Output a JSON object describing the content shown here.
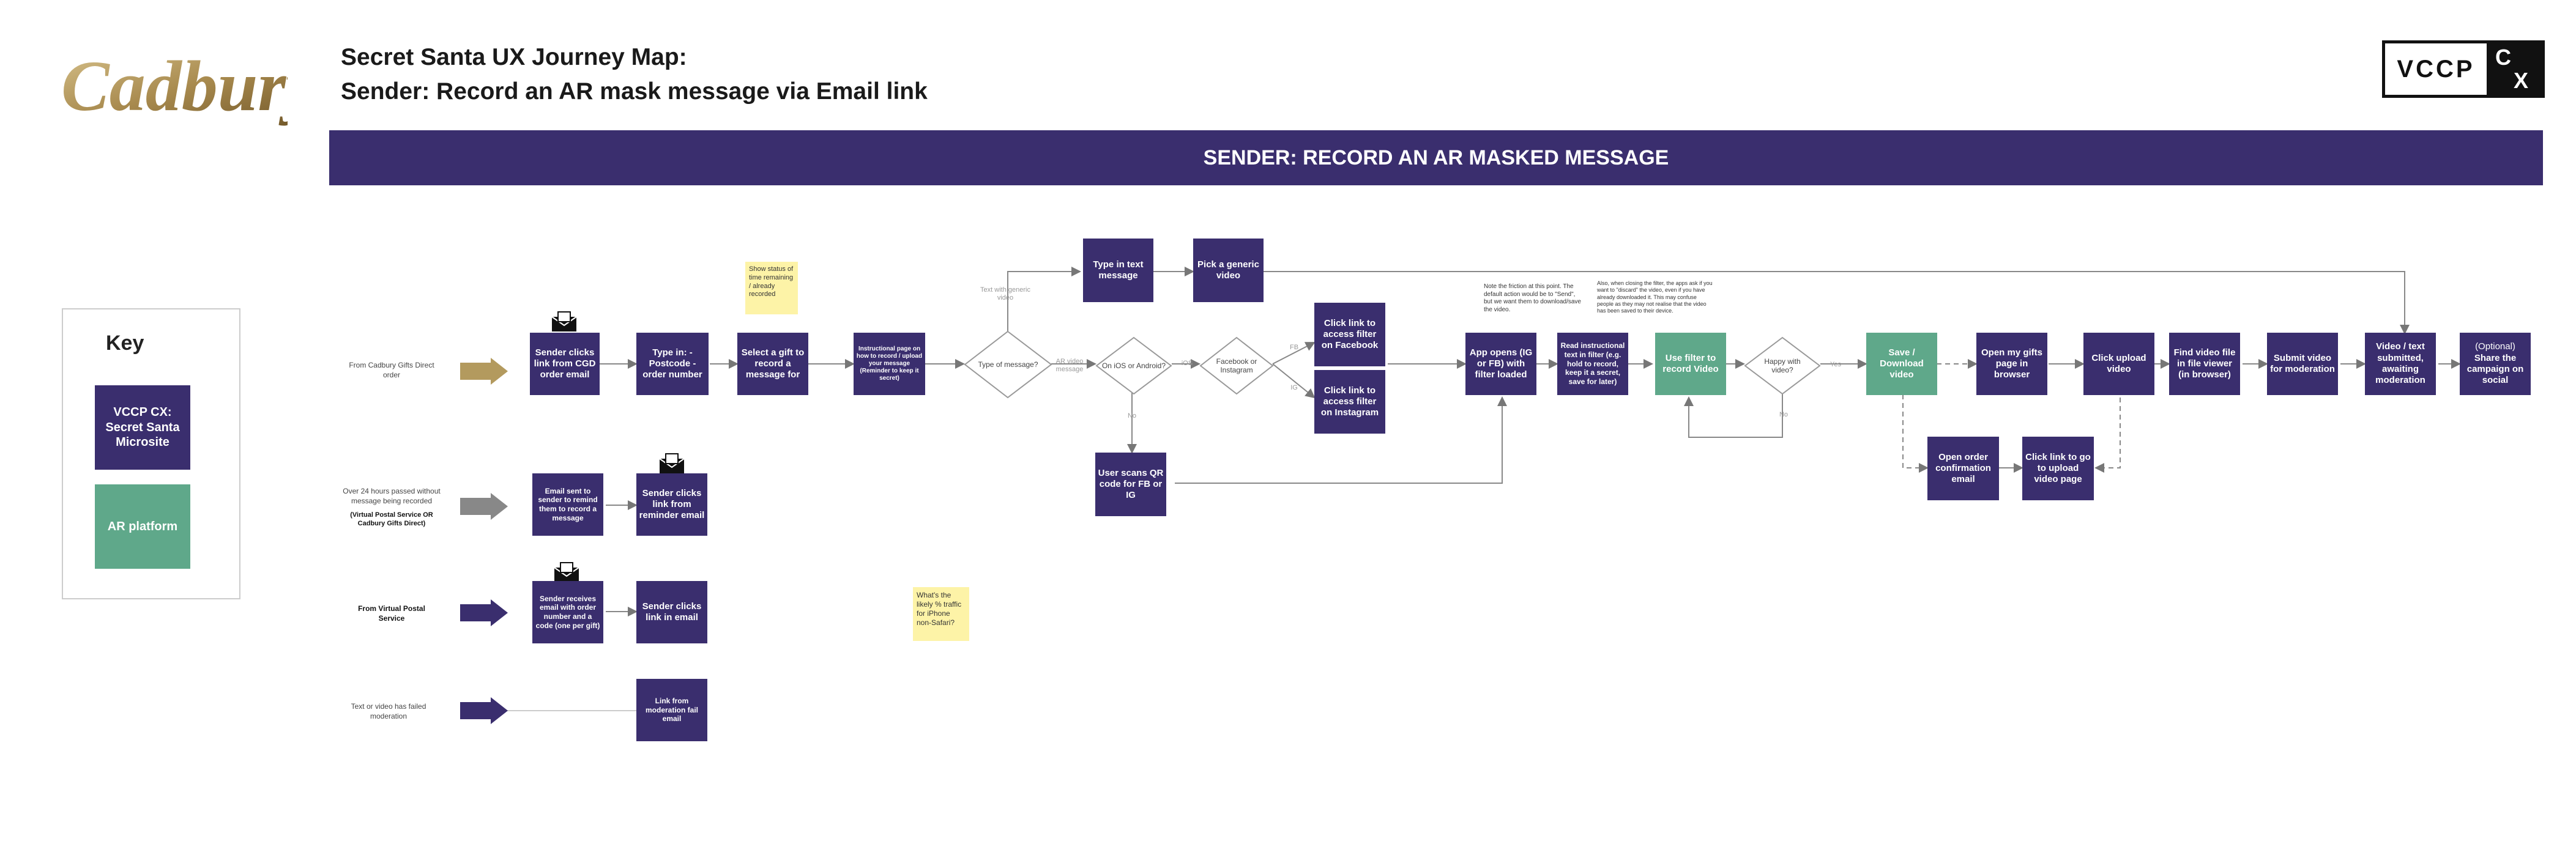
{
  "header": {
    "brand_logo_text": "Cadbury",
    "title_line1": "Secret Santa UX Journey Map:",
    "title_line2": "Sender: Record an AR mask message via Email link",
    "agency_logo_left": "VCCP",
    "agency_logo_right_top": "C",
    "agency_logo_right_bottom": "X"
  },
  "banner": {
    "title": "SENDER: RECORD AN AR MASKED MESSAGE"
  },
  "key": {
    "title": "Key",
    "items": [
      {
        "label": "VCCP CX: Secret Santa Microsite",
        "color": "#3a2e6e"
      },
      {
        "label": "AR platform",
        "color": "#5fa88a"
      }
    ]
  },
  "colors": {
    "primary": "#3a2e6e",
    "ar_platform": "#5fa88a",
    "gold": "#b39a5e",
    "grey": "#888888",
    "note": "#fdf3a7"
  },
  "entry_points": [
    {
      "label": "From Cadbury Gifts Direct order",
      "sub": ""
    },
    {
      "label": "Over 24 hours passed without message being recorded",
      "sub": "(Virtual Postal Service OR Cadbury Gifts Direct)"
    },
    {
      "label": "From Virtual Postal Service",
      "sub": ""
    },
    {
      "label": "Text or video has failed moderation",
      "sub": ""
    }
  ],
  "steps": {
    "sender_clicks_cgd": "Sender clicks link from CGD order email",
    "type_in": "Type in: - Postcode - order number",
    "select_gift": "Select a gift to record a message for",
    "email_sent": "Email sent to sender to remind them to record a message",
    "sender_clicks_reminder": "Sender clicks link from reminder email",
    "sender_receives": "Sender receives email with order number and a code (one per gift)",
    "sender_clicks_link": "Sender clicks link in email",
    "link_moderation": "Link from moderation fail email",
    "instructional_page": "Instructional page on how to record / upload your message (Reminder to keep it secret)",
    "type_text": "Type in text message",
    "pick_generic": "Pick a generic video",
    "user_scans_qr": "User scans QR code for FB or IG",
    "filter_facebook": "Click link to access filter on Facebook",
    "filter_instagram": "Click link to access filter on Instagram",
    "app_opens": "App opens (IG or FB) with filter loaded",
    "read_instructional": "Read instructional text in filter (e.g. hold to record, keep it a secret, save for later)",
    "use_filter": "Use filter to record Video",
    "save_download": "Save / Download video",
    "open_gifts_page": "Open my gifts page in browser",
    "click_upload": "Click upload video",
    "find_video": "Find video file in file viewer (in browser)",
    "submit_video": "Submit video for moderation",
    "video_submitted": "Video / text submitted, awaiting moderation",
    "share_optional": "(Optional)",
    "share": "Share the campaign on social",
    "open_order_email": "Open order confirmation email",
    "click_link_upload_page": "Click link to go to upload video page"
  },
  "decisions": {
    "type_of_message": "Type of message?",
    "ios_android": "On iOS or Android?",
    "fb_ig": "Facebook or Instagram",
    "happy": "Happy with video?"
  },
  "edge_labels": {
    "text_generic": "Text with generic video",
    "ar_video": "AR video message",
    "ios": "iOS",
    "no": "No",
    "fb": "FB",
    "ig": "IG",
    "yes": "Yes"
  },
  "notes": {
    "status_note": "Show status of time remaining / already recorded",
    "traffic_note": "What's the likely % traffic for iPhone non-Safari?",
    "friction_note": "Note the friction at this point. The default action would be to \"Send\", but we want them to download/save the video.",
    "filter_note": "Also, when closing the filter, the apps ask if you want to \"discard\" the video, even if you have already downloaded it. This may confuse people as they may not realise that the video has been saved to their device."
  }
}
